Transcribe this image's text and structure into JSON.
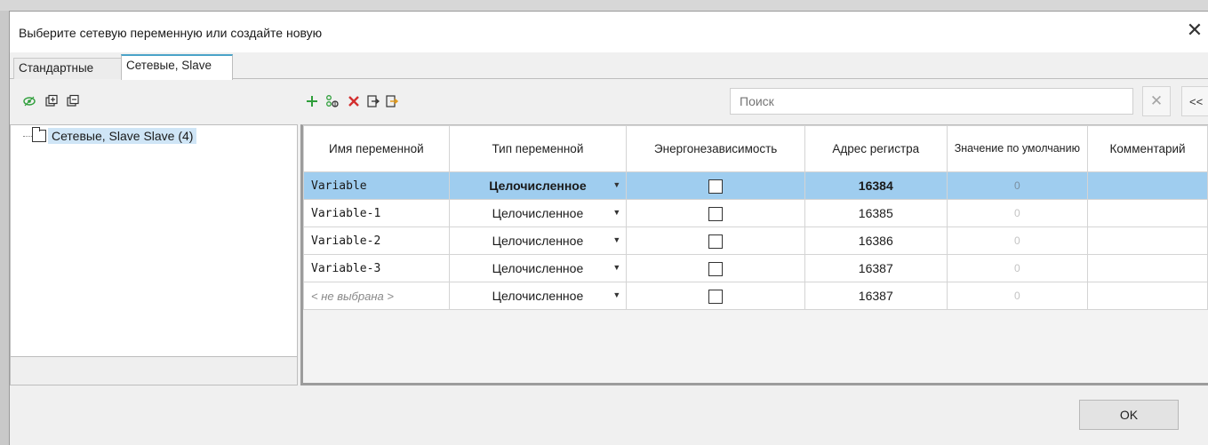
{
  "dialog": {
    "title": "Выберите сетевую переменную или создайте новую",
    "close_glyph": "✕"
  },
  "tabs": [
    {
      "label": "Стандартные",
      "active": false
    },
    {
      "label": "Сетевые, Slave",
      "active": true
    }
  ],
  "tree_toolbar": {
    "icons": [
      "visibility-icon",
      "expand-all-icon",
      "collapse-all-icon"
    ]
  },
  "grid_toolbar": {
    "icons": [
      "add-icon",
      "add-multiple-icon",
      "delete-icon",
      "import-icon",
      "export-icon"
    ]
  },
  "search": {
    "placeholder": "Поиск",
    "clear_glyph": "✕",
    "collapse_label": "<<"
  },
  "tree": {
    "root_label": "Сетевые, Slave Slave (4)"
  },
  "grid": {
    "columns": [
      "Имя переменной",
      "Тип переменной",
      "Энергонезависимость",
      "Адрес регистра",
      "Значение по умолчанию",
      "Комментарий"
    ],
    "rows": [
      {
        "name": "Variable",
        "type": "Целочисленное",
        "address": "16384",
        "default": "0",
        "comment": "",
        "selected": true
      },
      {
        "name": "Variable-1",
        "type": "Целочисленное",
        "address": "16385",
        "default": "0",
        "comment": "",
        "selected": false
      },
      {
        "name": "Variable-2",
        "type": "Целочисленное",
        "address": "16386",
        "default": "0",
        "comment": "",
        "selected": false
      },
      {
        "name": "Variable-3",
        "type": "Целочисленное",
        "address": "16387",
        "default": "0",
        "comment": "",
        "selected": false
      },
      {
        "name": "< не выбрана >",
        "type": "Целочисленное",
        "address": "16387",
        "default": "0",
        "comment": "",
        "selected": false
      }
    ]
  },
  "footer": {
    "ok_label": "OK"
  },
  "colors": {
    "selection": "#9fcdef",
    "tree_selection": "#cfe5f6",
    "add_green": "#2e9e3a",
    "delete_red": "#d32f2f",
    "tab_accent": "#4aa3c8"
  }
}
